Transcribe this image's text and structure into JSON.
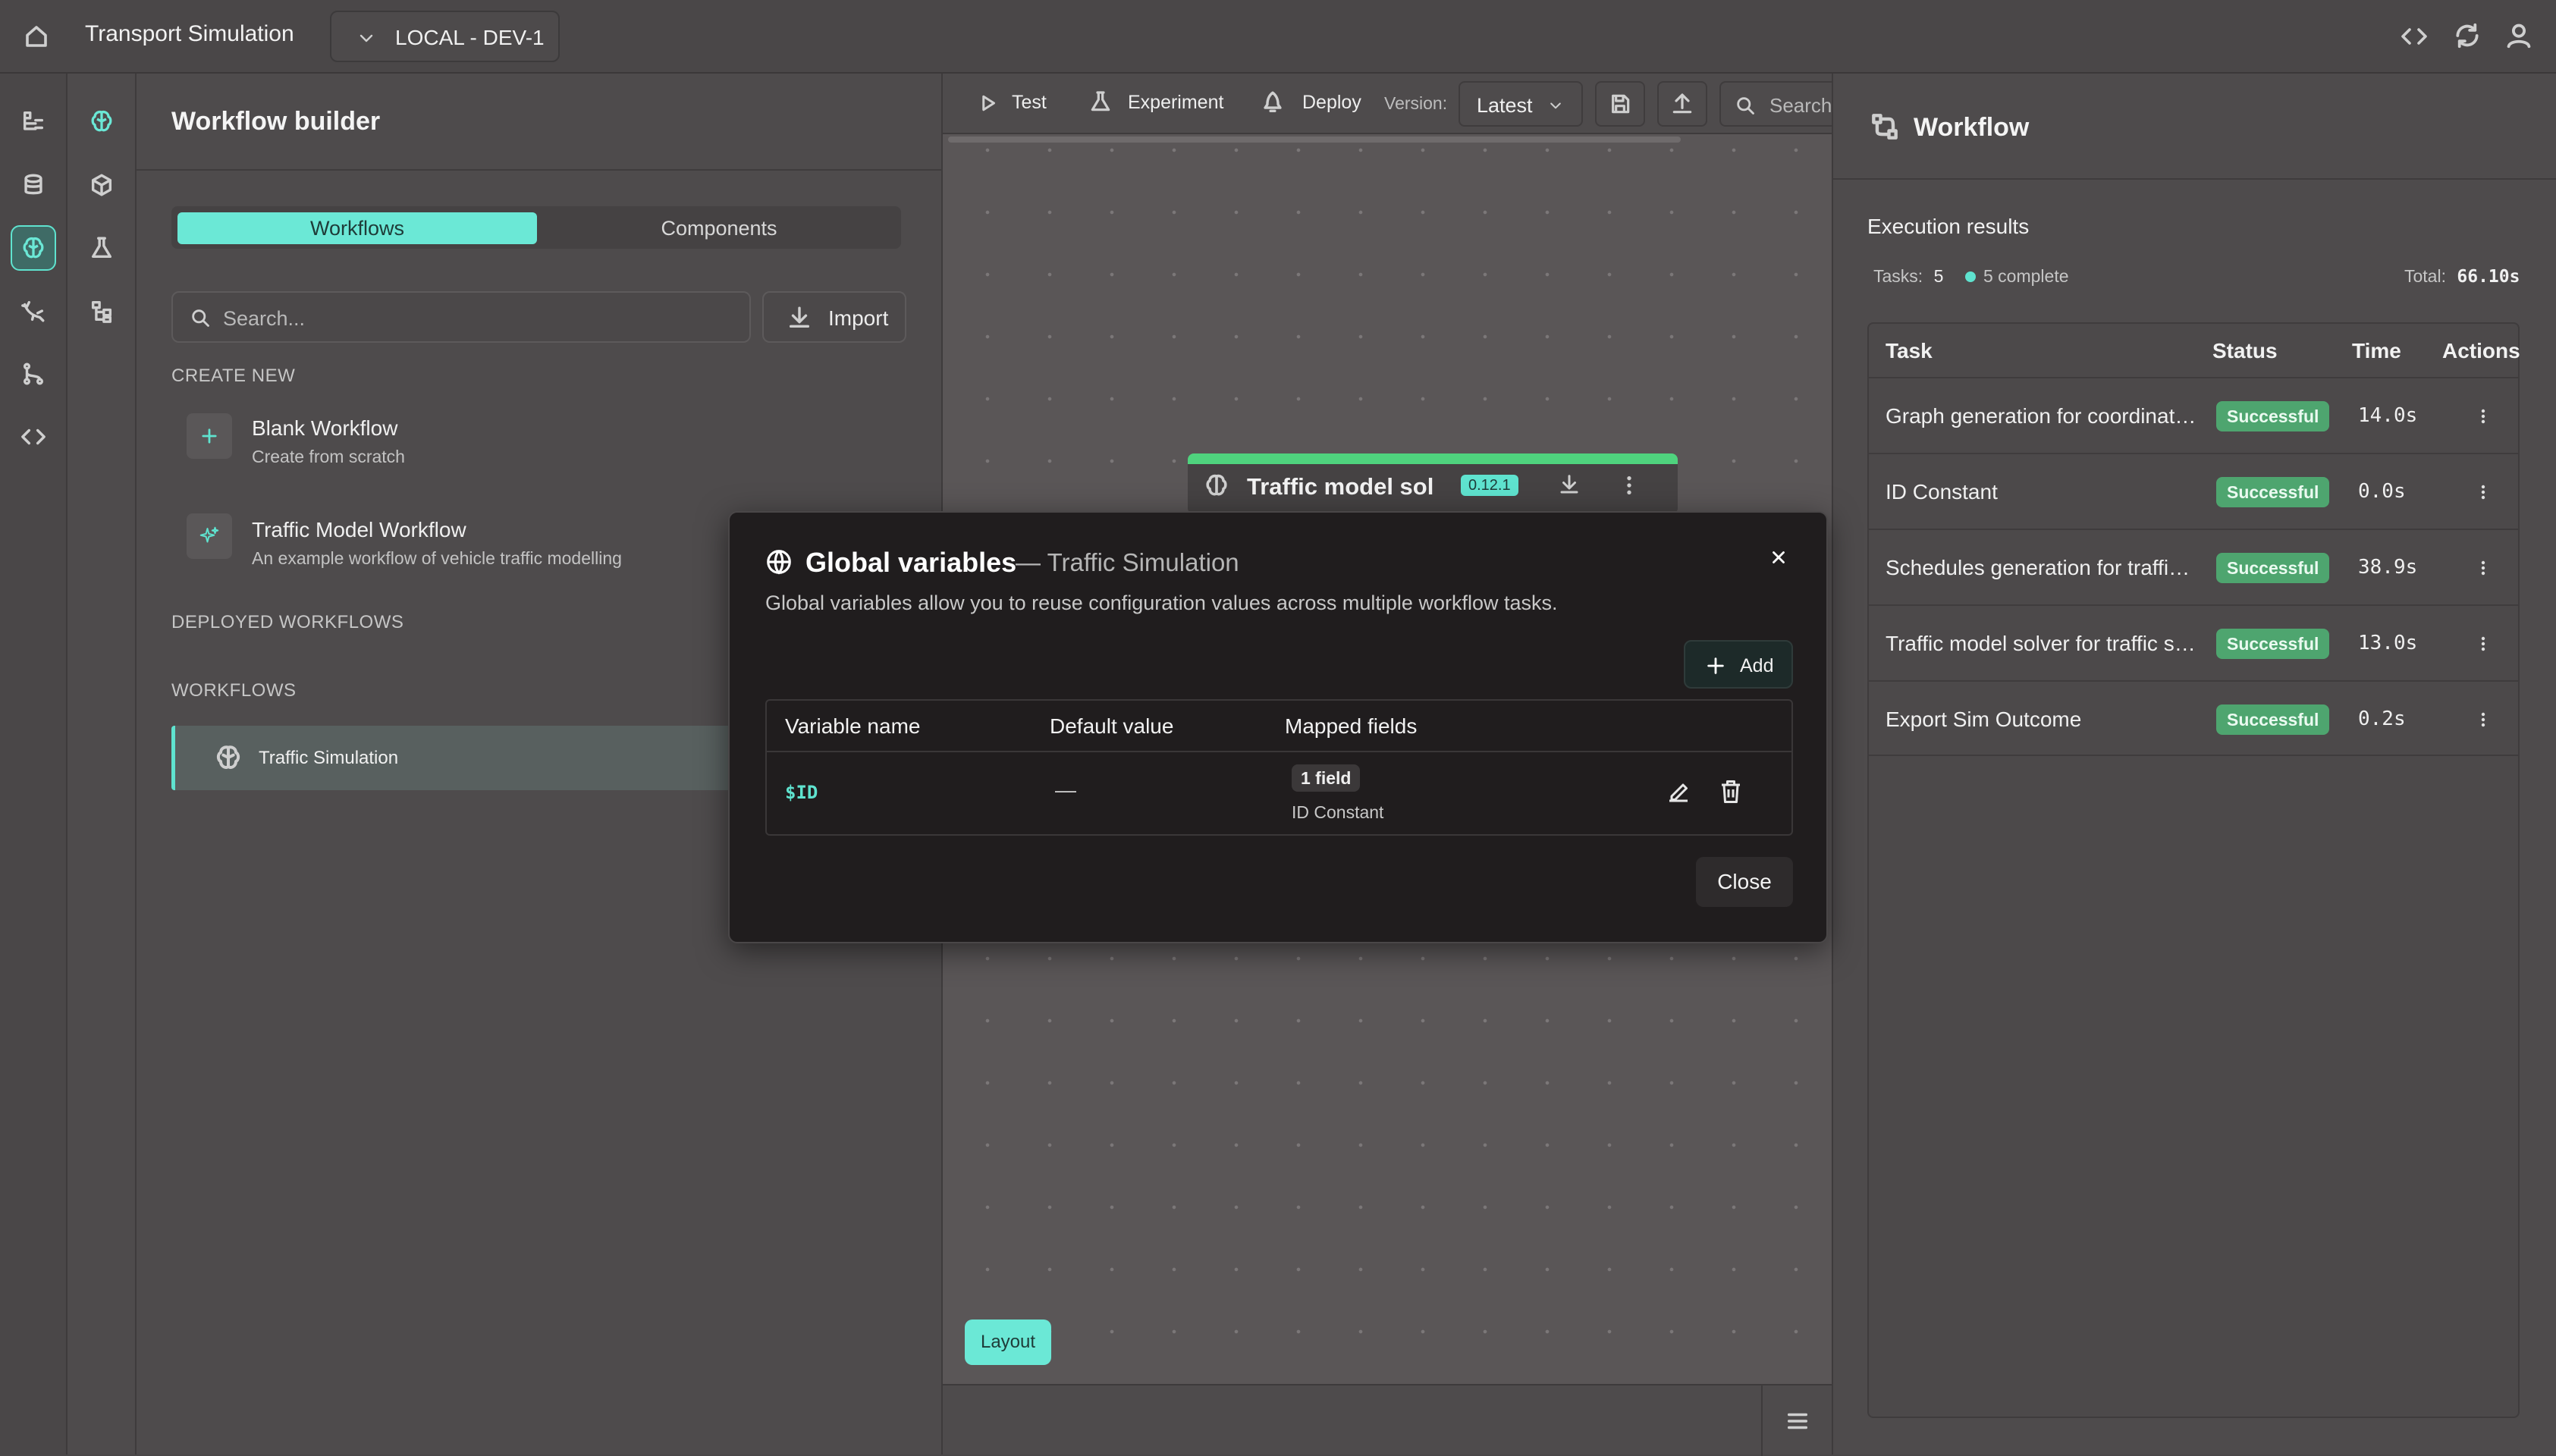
{
  "header": {
    "title": "Transport Simulation",
    "environment": "LOCAL - DEV-1",
    "icons": [
      "home-icon",
      "chevron-down-icon",
      "code-icon",
      "refresh-icon",
      "user-icon"
    ]
  },
  "rail": {
    "icons": [
      "tree-icon",
      "database-icon",
      "brain-icon",
      "gecko-icon",
      "branch-icon",
      "code-icon"
    ],
    "secondary_icons": [
      "brain-icon",
      "cube-icon",
      "flask-icon",
      "hierarchy-icon"
    ],
    "accent": "#5fe3cf"
  },
  "left_panel": {
    "title": "Workflow builder",
    "tabs": [
      {
        "label": "Workflows",
        "active": true
      },
      {
        "label": "Components",
        "active": false
      }
    ],
    "search_placeholder": "Search...",
    "import_label": "Import",
    "create_new_heading": "CREATE NEW",
    "create_items": [
      {
        "title": "Blank Workflow",
        "subtitle": "Create from scratch",
        "icon": "plus-icon"
      },
      {
        "title": "Traffic Model Workflow",
        "subtitle": "An example workflow of vehicle traffic modelling",
        "icon": "sparkle-icon"
      }
    ],
    "deployed_heading": "DEPLOYED WORKFLOWS",
    "workflows_heading": "WORKFLOWS",
    "workflows": [
      {
        "label": "Traffic Simulation",
        "icon": "brain-icon",
        "selected": true
      }
    ]
  },
  "toolbar": {
    "test_label": "Test",
    "experiment_label": "Experiment",
    "deploy_label": "Deploy",
    "version_label": "Version:",
    "version_value": "Latest",
    "search_placeholder": "Search"
  },
  "canvas": {
    "node_title": "Traffic model sol",
    "node_badge": "0.12.1",
    "layout_label": "Layout"
  },
  "right_panel": {
    "title": "Workflow",
    "execution_heading": "Execution results",
    "tasks_label": "Tasks:",
    "tasks_count": "5",
    "complete_label": "5 complete",
    "total_label": "Total:",
    "total_value": "66.10s",
    "columns": [
      "Task",
      "Status",
      "Time",
      "Actions"
    ],
    "rows": [
      {
        "task": "Graph generation for coordinates",
        "status": "Successful",
        "time": "14.0s"
      },
      {
        "task": "ID Constant",
        "status": "Successful",
        "time": "0.0s"
      },
      {
        "task": "Schedules generation for traffic ...",
        "status": "Successful",
        "time": "38.9s"
      },
      {
        "task": "Traffic model solver for traffic si...",
        "status": "Successful",
        "time": "13.0s"
      },
      {
        "task": "Export Sim Outcome",
        "status": "Successful",
        "time": "0.2s"
      }
    ],
    "status_color": "#4ea56f"
  },
  "modal": {
    "title": "Global variables",
    "subtitle": "— Traffic Simulation",
    "description": "Global variables allow you to reuse configuration values across multiple workflow tasks.",
    "add_label": "Add",
    "columns": [
      "Variable name",
      "Default value",
      "Mapped fields"
    ],
    "variables": [
      {
        "name": "$ID",
        "default": "—",
        "mapped_badge": "1 field",
        "mapped_field": "ID Constant"
      }
    ],
    "close_label": "Close"
  }
}
